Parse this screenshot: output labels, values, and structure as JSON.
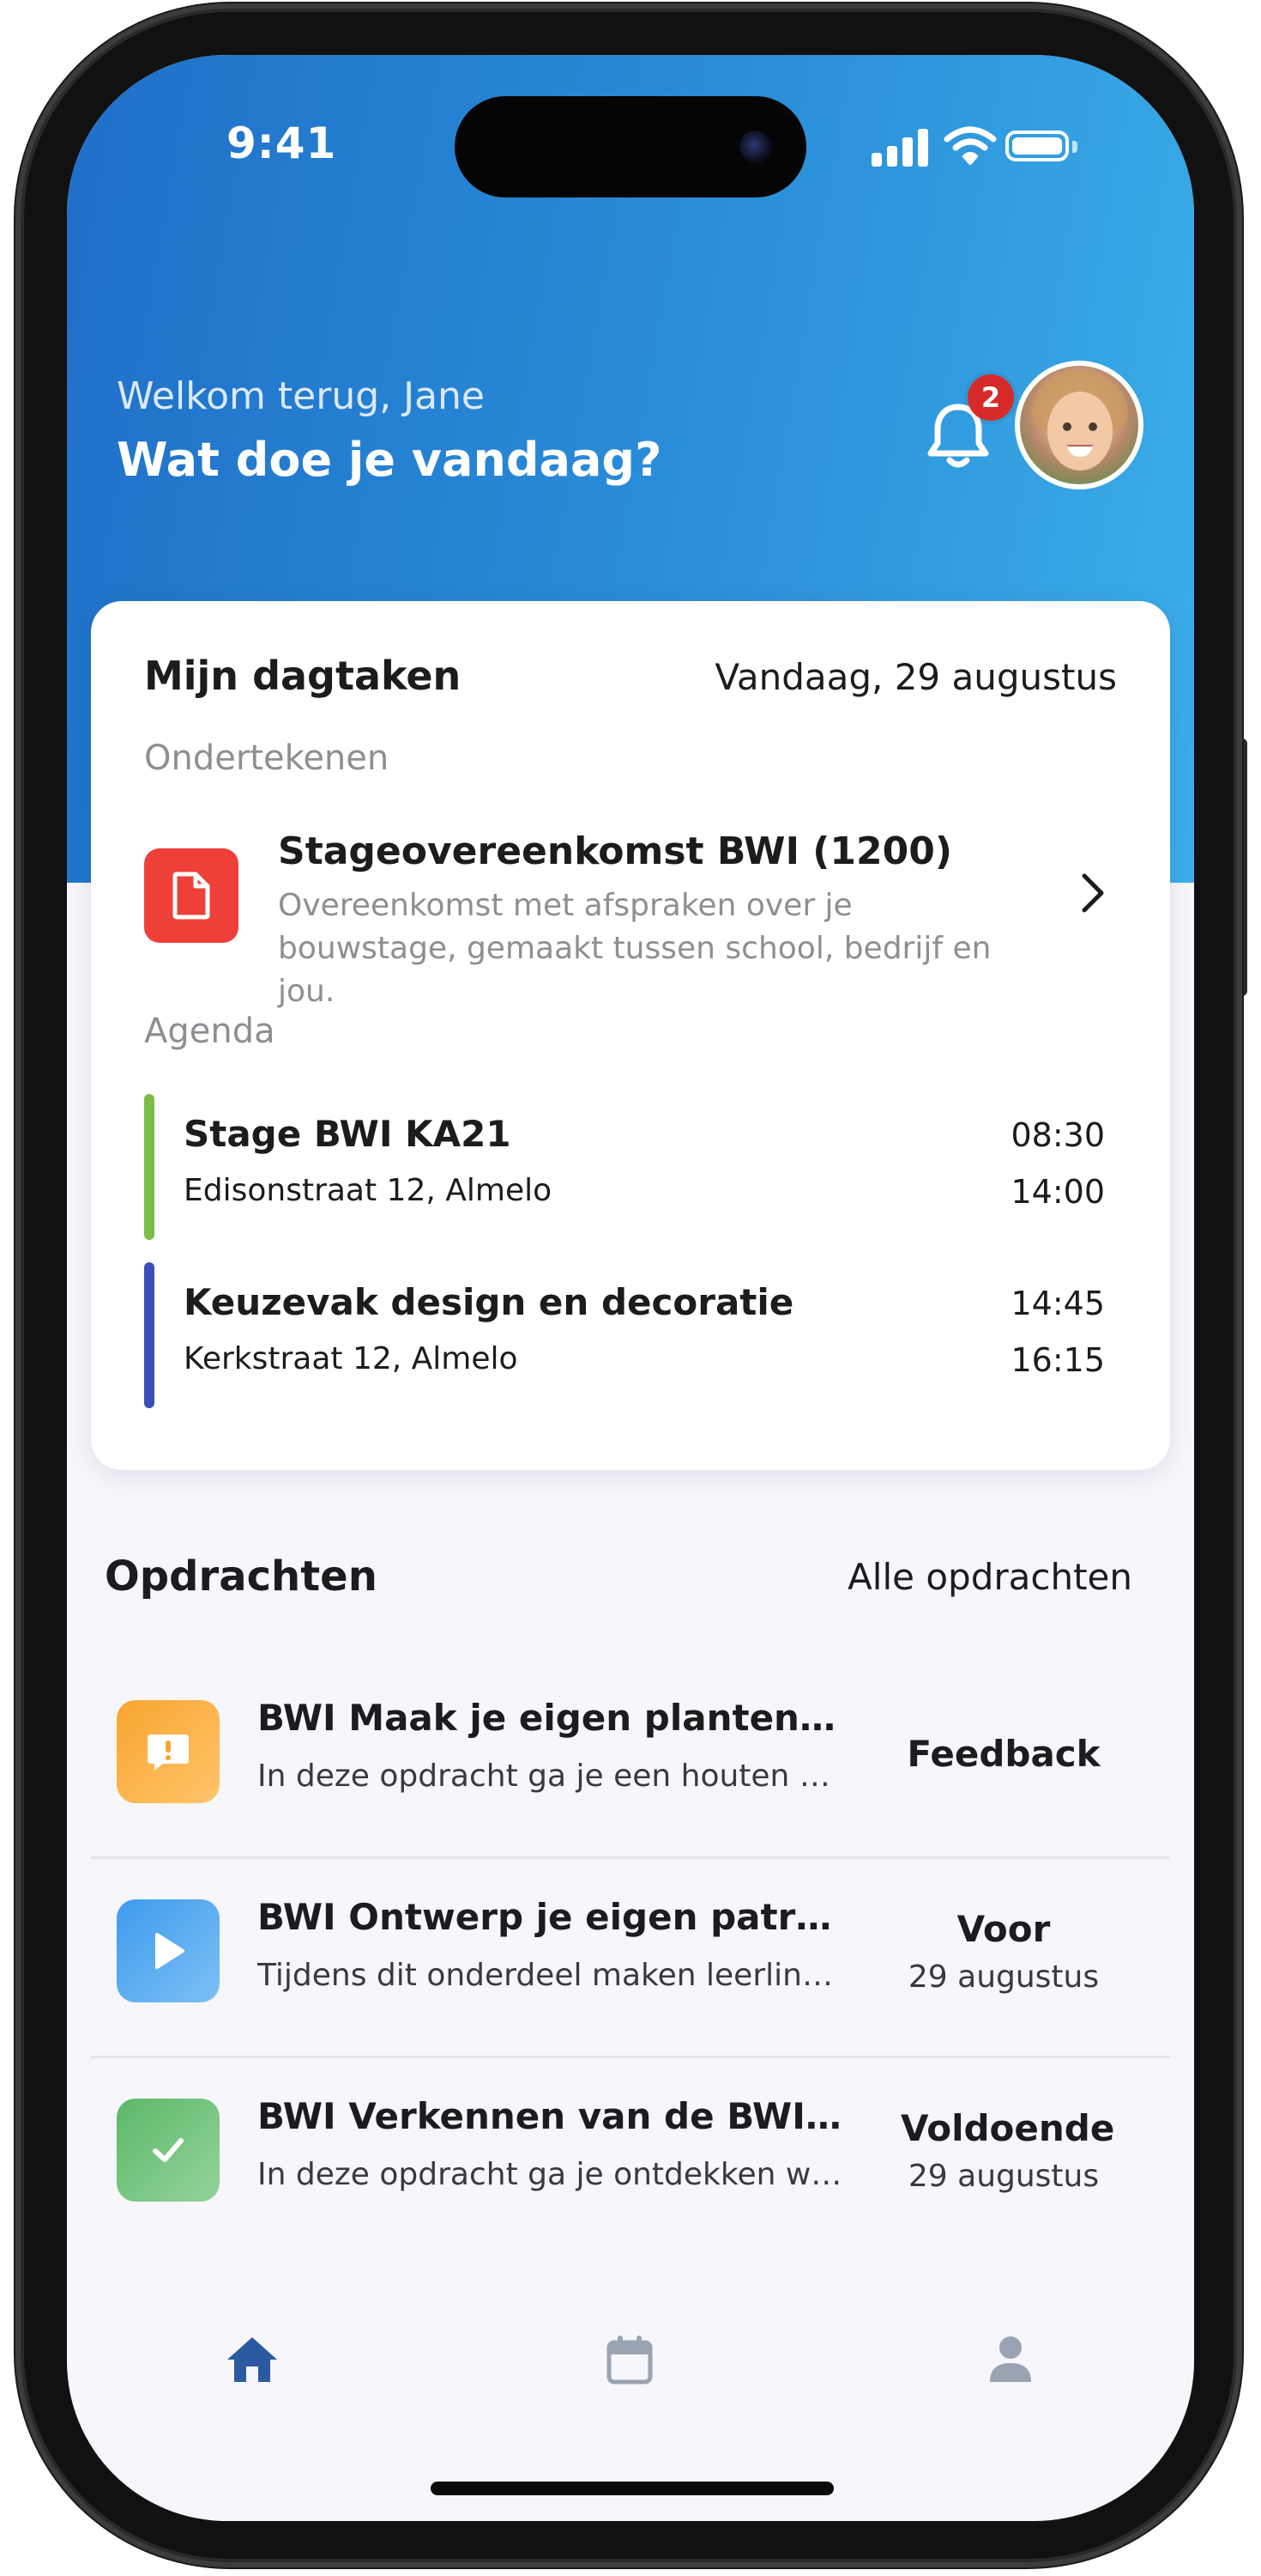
{
  "status_bar": {
    "time": "9:41"
  },
  "header": {
    "welcome": "Welkom terug, Jane",
    "subtitle": "Wat doe je vandaag?",
    "notification_count": "2",
    "colors": {
      "gradient_start": "#1f6fc8",
      "gradient_end": "#3caee9",
      "badge": "#d62a2a"
    }
  },
  "daily_tasks": {
    "title": "Mijn dagtaken",
    "date": "Vandaag, 29 augustus",
    "sign_label": "Ondertekenen",
    "sign_item": {
      "title": "Stageovereenkomst BWI (1200)",
      "description": "Overeenkomst met afspraken over je bouwstage, gemaakt tussen school, bedrijf en jou.",
      "icon": "document-icon",
      "color": "#ee4038"
    },
    "agenda_label": "Agenda",
    "agenda": [
      {
        "title": "Stage BWI KA21",
        "location": "Edisonstraat 12, Almelo",
        "start": "08:30",
        "end": "14:00",
        "color": "#7cbd45"
      },
      {
        "title": "Keuzevak design en decoratie",
        "location": "Kerkstraat 12, Almelo",
        "start": "14:45",
        "end": "16:15",
        "color": "#3b4db8"
      }
    ]
  },
  "assignments": {
    "title": "Opdrachten",
    "link": "Alle opdrachten",
    "items": [
      {
        "title": "BWI Maak je eigen plantenstan...",
        "description": "In deze opdracht ga je een houten pla...",
        "status": "Feedback",
        "status_date": "",
        "icon": "feedback-icon",
        "color": "#f7a52f"
      },
      {
        "title": "BWI Ontwerp je eigen patroon ...",
        "description": "Tijdens dit onderdeel maken leerlinge...",
        "status": "Voor",
        "status_date": "29 augustus",
        "icon": "play-icon",
        "color": "#3f9bec"
      },
      {
        "title": "BWI Verkennen van de BWI-se...",
        "description": "In deze opdracht ga je ontdekken wat...",
        "status": "Voldoende",
        "status_date": "29 augustus",
        "icon": "check-icon",
        "color": "#5cb868"
      }
    ]
  },
  "tab_bar": {
    "items": [
      {
        "icon": "home-icon",
        "active": true
      },
      {
        "icon": "calendar-icon",
        "active": false
      },
      {
        "icon": "profile-icon",
        "active": false
      }
    ],
    "colors": {
      "active": "#2c5aa0",
      "inactive": "#9aa3b2"
    }
  }
}
